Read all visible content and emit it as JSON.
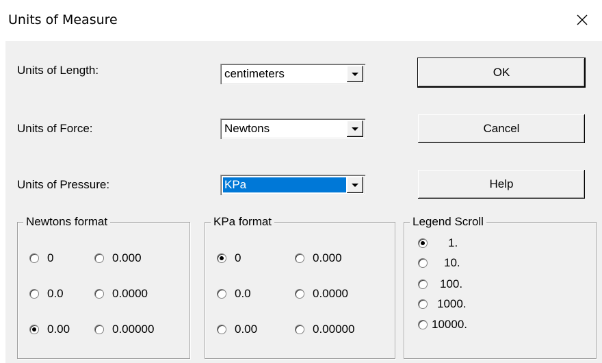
{
  "window": {
    "title": "Units of Measure"
  },
  "fields": {
    "length_label": "Units of Length:",
    "length_value": "centimeters",
    "force_label": "Units of Force:",
    "force_value": "Newtons",
    "pressure_label": "Units of Pressure:",
    "pressure_value": "KPa"
  },
  "buttons": {
    "ok": "OK",
    "cancel": "Cancel",
    "help": "Help"
  },
  "newtons_format": {
    "title": "Newtons format",
    "options": [
      "0",
      "0.000",
      "0.0",
      "0.0000",
      "0.00",
      "0.00000"
    ],
    "selected": "0.00"
  },
  "kpa_format": {
    "title": "KPa format",
    "options": [
      "0",
      "0.000",
      "0.0",
      "0.0000",
      "0.00",
      "0.00000"
    ],
    "selected": "0"
  },
  "legend_scroll": {
    "title": "Legend Scroll",
    "options": [
      "1.",
      "10.",
      "100.",
      "1000.",
      "10000."
    ],
    "selected": "1."
  },
  "colors": {
    "selection": "#0078d7",
    "dialog_bg": "#f0f0f0"
  }
}
